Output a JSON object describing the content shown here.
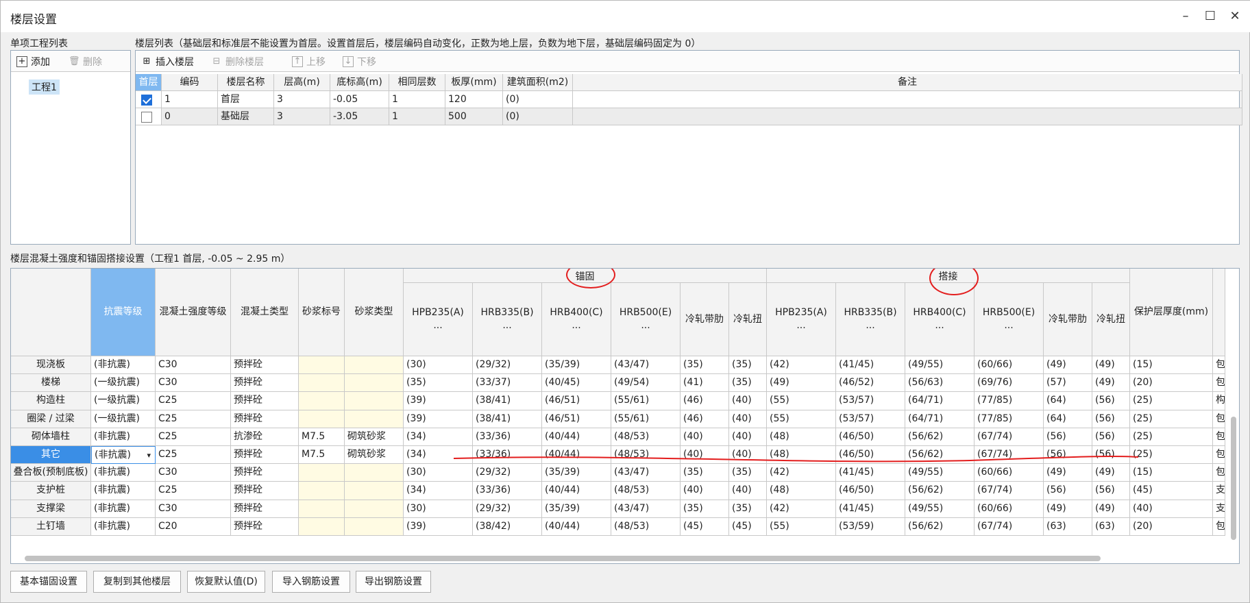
{
  "window": {
    "title": "楼层设置",
    "minimize": "–",
    "maximize": "☐",
    "close": "✕"
  },
  "project_panel": {
    "label": "单项工程列表",
    "add": "添加",
    "delete": "删除",
    "items": [
      "工程1"
    ]
  },
  "floor_panel": {
    "label": "楼层列表（基础层和标准层不能设置为首层。设置首层后，楼层编码自动变化，正数为地上层，负数为地下层，基础层编码固定为 0）",
    "toolbar": {
      "insert": "插入楼层",
      "delete": "删除楼层",
      "up": "上移",
      "down": "下移"
    },
    "columns": [
      "首层",
      "编码",
      "楼层名称",
      "层高(m)",
      "底标高(m)",
      "相同层数",
      "板厚(mm)",
      "建筑面积(m2)",
      "备注"
    ],
    "rows": [
      {
        "checked": true,
        "code": "1",
        "name": "首层",
        "height": "3",
        "bottom": "-0.05",
        "same": "1",
        "thick": "120",
        "area": "(0)",
        "note": ""
      },
      {
        "checked": false,
        "code": "0",
        "name": "基础层",
        "height": "3",
        "bottom": "-3.05",
        "same": "1",
        "thick": "500",
        "area": "(0)",
        "note": ""
      }
    ]
  },
  "strength_panel": {
    "label": "楼层混凝土强度和锚固搭接设置（工程1 首层, -0.05 ~ 2.95 m）",
    "group_anchor": "锚固",
    "group_lap": "搭接",
    "headers": [
      "抗震等级",
      "混凝土强度等级",
      "混凝土类型",
      "砂浆标号",
      "砂浆类型",
      "HPB235(A)\n...",
      "HRB335(B)\n...",
      "HRB400(C)\n...",
      "HRB500(E)\n...",
      "冷轧带肋",
      "冷轧扭",
      "HPB235(A)\n...",
      "HRB335(B)\n...",
      "HRB400(C)\n...",
      "HRB500(E)\n...",
      "冷轧带肋",
      "冷轧扭",
      "保护层厚度(mm)",
      ""
    ],
    "rows": [
      {
        "name": "现浇板",
        "cells": [
          "(非抗震)",
          "C30",
          "预拌砼",
          "",
          "",
          "(30)",
          "(29/32)",
          "(35/39)",
          "(43/47)",
          "(35)",
          "(35)",
          "(42)",
          "(41/45)",
          "(49/55)",
          "(60/66)",
          "(49)",
          "(49)",
          "(15)",
          "包"
        ]
      },
      {
        "name": "楼梯",
        "cells": [
          "(一级抗震)",
          "C30",
          "预拌砼",
          "",
          "",
          "(35)",
          "(33/37)",
          "(40/45)",
          "(49/54)",
          "(41)",
          "(35)",
          "(49)",
          "(46/52)",
          "(56/63)",
          "(69/76)",
          "(57)",
          "(49)",
          "(20)",
          "包"
        ]
      },
      {
        "name": "构造柱",
        "cells": [
          "(一级抗震)",
          "C25",
          "预拌砼",
          "",
          "",
          "(39)",
          "(38/41)",
          "(46/51)",
          "(55/61)",
          "(46)",
          "(40)",
          "(55)",
          "(53/57)",
          "(64/71)",
          "(77/85)",
          "(64)",
          "(56)",
          "(25)",
          "构"
        ]
      },
      {
        "name": "圈梁 / 过梁",
        "cells": [
          "(一级抗震)",
          "C25",
          "预拌砼",
          "",
          "",
          "(39)",
          "(38/41)",
          "(46/51)",
          "(55/61)",
          "(46)",
          "(40)",
          "(55)",
          "(53/57)",
          "(64/71)",
          "(77/85)",
          "(64)",
          "(56)",
          "(25)",
          "包"
        ]
      },
      {
        "name": "砌体墙柱",
        "cells": [
          "(非抗震)",
          "C25",
          "抗渗砼",
          "M7.5",
          "砌筑砂浆",
          "(34)",
          "(33/36)",
          "(40/44)",
          "(48/53)",
          "(40)",
          "(40)",
          "(48)",
          "(46/50)",
          "(56/62)",
          "(67/74)",
          "(56)",
          "(56)",
          "(25)",
          "包"
        ]
      },
      {
        "name": "其它",
        "selected": true,
        "cells": [
          "(非抗震)",
          "C25",
          "预拌砼",
          "M7.5",
          "砌筑砂浆",
          "(34)",
          "(33/36)",
          "(40/44)",
          "(48/53)",
          "(40)",
          "(40)",
          "(48)",
          "(46/50)",
          "(56/62)",
          "(67/74)",
          "(56)",
          "(56)",
          "(25)",
          "包"
        ]
      },
      {
        "name": "叠合板(预制底板)",
        "cells": [
          "(非抗震)",
          "C30",
          "预拌砼",
          "",
          "",
          "(30)",
          "(29/32)",
          "(35/39)",
          "(43/47)",
          "(35)",
          "(35)",
          "(42)",
          "(41/45)",
          "(49/55)",
          "(60/66)",
          "(49)",
          "(49)",
          "(15)",
          "包"
        ]
      },
      {
        "name": "支护桩",
        "cells": [
          "(非抗震)",
          "C25",
          "预拌砼",
          "",
          "",
          "(34)",
          "(33/36)",
          "(40/44)",
          "(48/53)",
          "(40)",
          "(40)",
          "(48)",
          "(46/50)",
          "(56/62)",
          "(67/74)",
          "(56)",
          "(56)",
          "(45)",
          "支"
        ]
      },
      {
        "name": "支撑梁",
        "cells": [
          "(非抗震)",
          "C30",
          "预拌砼",
          "",
          "",
          "(30)",
          "(29/32)",
          "(35/39)",
          "(43/47)",
          "(35)",
          "(35)",
          "(42)",
          "(41/45)",
          "(49/55)",
          "(60/66)",
          "(49)",
          "(49)",
          "(40)",
          "支"
        ]
      },
      {
        "name": "土钉墙",
        "cells": [
          "(非抗震)",
          "C20",
          "预拌砼",
          "",
          "",
          "(39)",
          "(38/42)",
          "(40/44)",
          "(48/53)",
          "(45)",
          "(45)",
          "(55)",
          "(53/59)",
          "(56/62)",
          "(67/74)",
          "(63)",
          "(63)",
          "(20)",
          "包"
        ]
      }
    ]
  },
  "buttons": [
    "基本锚固设置",
    "复制到其他楼层",
    "恢复默认值(D)",
    "导入钢筋设置",
    "导出钢筋设置"
  ],
  "colors": {
    "accent": "#3a8ee6",
    "header_sel": "#7fb8f0",
    "annotation": "#e31d1d",
    "yellow": "#fffbe3"
  }
}
